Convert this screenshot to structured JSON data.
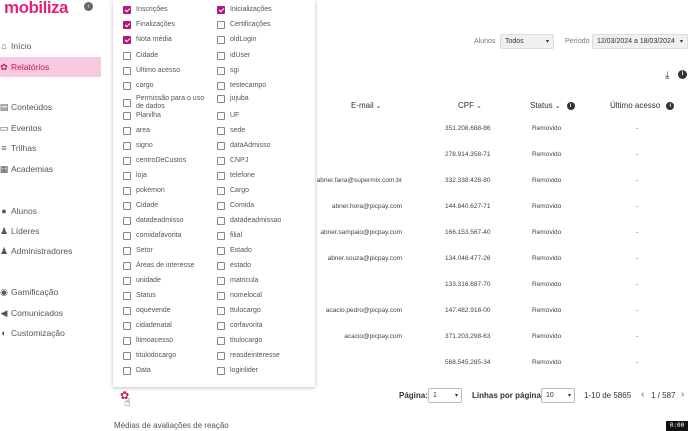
{
  "brand": {
    "logo": "mobiliza",
    "back_icon": "‹",
    "accent": "#e0267a"
  },
  "sidebar": {
    "items": [
      {
        "label": "Início",
        "icon": "home-icon",
        "glyph": "⌂"
      },
      {
        "label": "Relatórios",
        "icon": "chart-icon",
        "glyph": "✿",
        "active": true
      },
      {
        "label": "Conteúdos",
        "icon": "content-icon",
        "glyph": "▤"
      },
      {
        "label": "Eventos",
        "icon": "event-icon",
        "glyph": "▭"
      },
      {
        "label": "Trilhas",
        "icon": "trail-icon",
        "glyph": "≡"
      },
      {
        "label": "Academias",
        "icon": "academy-icon",
        "glyph": "▦"
      },
      {
        "label": "Alunos",
        "icon": "student-icon",
        "glyph": "●"
      },
      {
        "label": "Líderes",
        "icon": "leader-icon",
        "glyph": "♟"
      },
      {
        "label": "Administradores",
        "icon": "admin-icon",
        "glyph": "♟"
      },
      {
        "label": "Gamificação",
        "icon": "game-icon",
        "glyph": "◉"
      },
      {
        "label": "Comunicados",
        "icon": "megaphone-icon",
        "glyph": "◀"
      },
      {
        "label": "Customização",
        "icon": "customize-icon",
        "glyph": "◐"
      }
    ]
  },
  "filters": {
    "alunos_label": "Alunos",
    "alunos_value": "Todos",
    "periodo_label": "Período",
    "periodo_value": "12/03/2024 a 18/03/2024",
    "caret": "▾"
  },
  "toolbar": {
    "download_icon": "⤓",
    "info_icon": "i"
  },
  "table": {
    "headers": {
      "email": "E-mail",
      "cpf": "CPF",
      "status": "Status",
      "last_access": "Último acesso",
      "chevron": "⌄",
      "info": "i"
    },
    "rows": [
      {
        "email": "",
        "cpf": "351.208.688-86",
        "status": "Removido",
        "last": "-"
      },
      {
        "email": "",
        "cpf": "278.914.358-71",
        "status": "Removido",
        "last": "-"
      },
      {
        "email": "abner.faria@supermix.com.br",
        "cpf": "332.338.428-80",
        "status": "Removido",
        "last": "-"
      },
      {
        "email": "abner.hora@picpay.com",
        "cpf": "144.840.627-71",
        "status": "Removido",
        "last": "-"
      },
      {
        "email": "abner.sampaio@picpay.com",
        "cpf": "166.153.567-40",
        "status": "Removido",
        "last": "-"
      },
      {
        "email": "abner.souza@picpay.com",
        "cpf": "134.046.477-26",
        "status": "Removido",
        "last": "-"
      },
      {
        "email": "",
        "cpf": "133.316.687-70",
        "status": "Removido",
        "last": "-"
      },
      {
        "email": "acacio.pedro@picpay.com",
        "cpf": "147.482.918-00",
        "status": "Removido",
        "last": "-"
      },
      {
        "email": "acacio@picpay.com",
        "cpf": "371.203.298-63",
        "status": "Removido",
        "last": "-"
      },
      {
        "email": "",
        "cpf": "568.545.285-34",
        "status": "Removido",
        "last": "-"
      }
    ]
  },
  "pagination": {
    "page_label": "Página:",
    "page_value": "1",
    "rows_label": "Linhas por página:",
    "rows_value": "10",
    "range": "1-10 de 5865",
    "prev": "‹",
    "next": "›",
    "pages": "1 / 587"
  },
  "section": {
    "title": "Médias de avaliações de reação"
  },
  "settings": {
    "gear_icon": "✿",
    "cursor": "☝"
  },
  "columns_panel": {
    "left": [
      {
        "label": "Inscrições",
        "checked": true
      },
      {
        "label": "Finalizações",
        "checked": true
      },
      {
        "label": "Nota média",
        "checked": true
      },
      {
        "label": "Cidade",
        "checked": false
      },
      {
        "label": "Último acesso",
        "checked": false
      },
      {
        "label": "cargo",
        "checked": false
      },
      {
        "label": "Permissão para o uso de dados",
        "checked": false
      },
      {
        "label": "Planilha",
        "checked": false
      },
      {
        "label": "area",
        "checked": false
      },
      {
        "label": "signo",
        "checked": false
      },
      {
        "label": "centroDeCustos",
        "checked": false
      },
      {
        "label": "loja",
        "checked": false
      },
      {
        "label": "pokemon",
        "checked": false
      },
      {
        "label": "Cidade",
        "checked": false
      },
      {
        "label": "datadeadmisso",
        "checked": false
      },
      {
        "label": "comidafavorita",
        "checked": false
      },
      {
        "label": "Setor",
        "checked": false
      },
      {
        "label": "Áreas de interesse",
        "checked": false
      },
      {
        "label": "unidade",
        "checked": false
      },
      {
        "label": "Status",
        "checked": false
      },
      {
        "label": "oquevende",
        "checked": false
      },
      {
        "label": "cidadenatal",
        "checked": false
      },
      {
        "label": "ltimoacesso",
        "checked": false
      },
      {
        "label": "titulodocargo",
        "checked": false
      },
      {
        "label": "Data",
        "checked": false
      }
    ],
    "right": [
      {
        "label": "Inicializações",
        "checked": true
      },
      {
        "label": "Certificações",
        "checked": false
      },
      {
        "label": "oldLogin",
        "checked": false
      },
      {
        "label": "idUser",
        "checked": false
      },
      {
        "label": "sgi",
        "checked": false
      },
      {
        "label": "testecampo",
        "checked": false
      },
      {
        "label": "jujuba",
        "checked": false
      },
      {
        "label": "UF",
        "checked": false
      },
      {
        "label": "sede",
        "checked": false
      },
      {
        "label": "dataAdmisso",
        "checked": false
      },
      {
        "label": "CNPJ",
        "checked": false
      },
      {
        "label": "telefone",
        "checked": false
      },
      {
        "label": "Cargo",
        "checked": false
      },
      {
        "label": "Comida",
        "checked": false
      },
      {
        "label": "datadeadmissao",
        "checked": false
      },
      {
        "label": "filial",
        "checked": false
      },
      {
        "label": "Estado",
        "checked": false
      },
      {
        "label": "estado",
        "checked": false
      },
      {
        "label": "matricula",
        "checked": false
      },
      {
        "label": "nomelocal",
        "checked": false
      },
      {
        "label": "ttulocargo",
        "checked": false
      },
      {
        "label": "corfavorita",
        "checked": false
      },
      {
        "label": "titulocargo",
        "checked": false
      },
      {
        "label": "reasdeinteresse",
        "checked": false
      },
      {
        "label": "loginlider",
        "checked": false
      }
    ]
  },
  "recording": {
    "timer": "0:00"
  }
}
